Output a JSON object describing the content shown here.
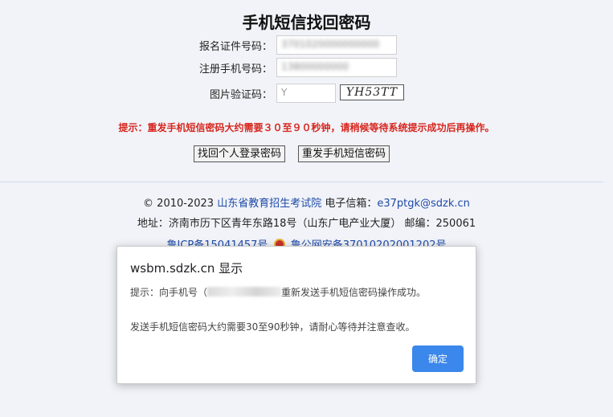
{
  "page": {
    "title": "手机短信找回密码"
  },
  "form": {
    "id_label": "报名证件号码：",
    "phone_label": "注册手机号码：",
    "captcha_label": "图片验证码：",
    "captcha_input_value": "Y",
    "captcha_image_text": "YH53TT"
  },
  "tip": "提示：重发手机短信密码大约需要３０至９０秒钟，请稍候等待系统提示成功后再操作。",
  "buttons": {
    "recover_login": "找回个人登录密码",
    "resend_sms": "重发手机短信密码"
  },
  "footer": {
    "copyright_prefix": "© 2010-2023",
    "org_name": "山东省教育招生考试院",
    "email_label": "电子信箱：",
    "email": "e37ptgk@sdzk.cn",
    "address": "地址：济南市历下区青年东路18号（山东广电产业大厦） 邮编：250061",
    "icp": "鲁ICP备15041457号",
    "police": "鲁公网安备37010202001202号"
  },
  "dialog": {
    "title": "wsbm.sdzk.cn 显示",
    "msg1_prefix": "提示：向手机号（",
    "msg1_suffix": "重新发送手机短信密码操作成功。",
    "msg2": "发送手机短信密码大约需要30至90秒钟，请耐心等待并注意查收。",
    "ok_label": "确定"
  },
  "colors": {
    "tip": "#d8261e",
    "link": "#1f4aa8",
    "primary_button": "#1a73e8",
    "background": "#f1f3f8"
  }
}
